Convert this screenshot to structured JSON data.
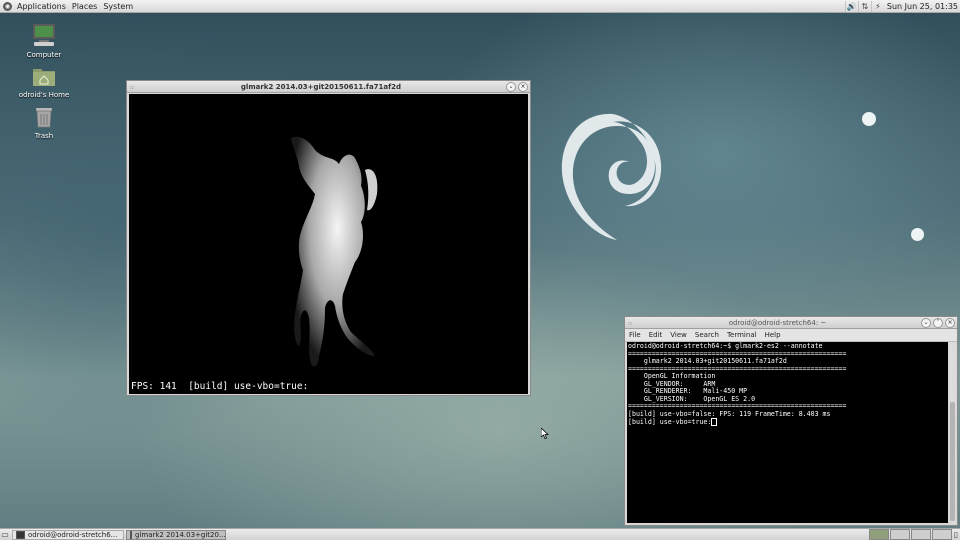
{
  "top_panel": {
    "menus": [
      "Applications",
      "Places",
      "System"
    ],
    "tray_icons": [
      "speaker-icon",
      "network-icon",
      "power-icon"
    ],
    "clock": "Sun Jun 25, 01:35"
  },
  "desktop": {
    "icons": [
      {
        "label": "Computer",
        "icon": "computer-icon"
      },
      {
        "label": "odroid's Home",
        "icon": "home-folder-icon"
      },
      {
        "label": "Trash",
        "icon": "trash-icon"
      }
    ]
  },
  "glmark_window": {
    "title": "glmark2 2014.03+git20150611.fa71af2d",
    "status_line": "FPS: 141  [build] use-vbo=true:"
  },
  "terminal_window": {
    "title": "odroid@odroid-stretch64: ~",
    "menu": [
      "File",
      "Edit",
      "View",
      "Search",
      "Terminal",
      "Help"
    ],
    "lines": [
      "odroid@odroid-stretch64:~$ glmark2-es2 --annotate",
      "=======================================================",
      "    glmark2 2014.03+git20150611.fa71af2d",
      "=======================================================",
      "    OpenGL Information",
      "    GL_VENDOR:     ARM",
      "    GL_RENDERER:   Mali-450 MP",
      "    GL_VERSION:    OpenGL ES 2.0",
      "=======================================================",
      "[build] use-vbo=false: FPS: 119 FrameTime: 8.403 ms",
      "[build] use-vbo=true:"
    ]
  },
  "bottom_panel": {
    "tasks": [
      {
        "label": "odroid@odroid-stretch6...",
        "active": false
      },
      {
        "label": "glmark2 2014.03+git20...",
        "active": true
      }
    ],
    "workspaces": 4
  }
}
